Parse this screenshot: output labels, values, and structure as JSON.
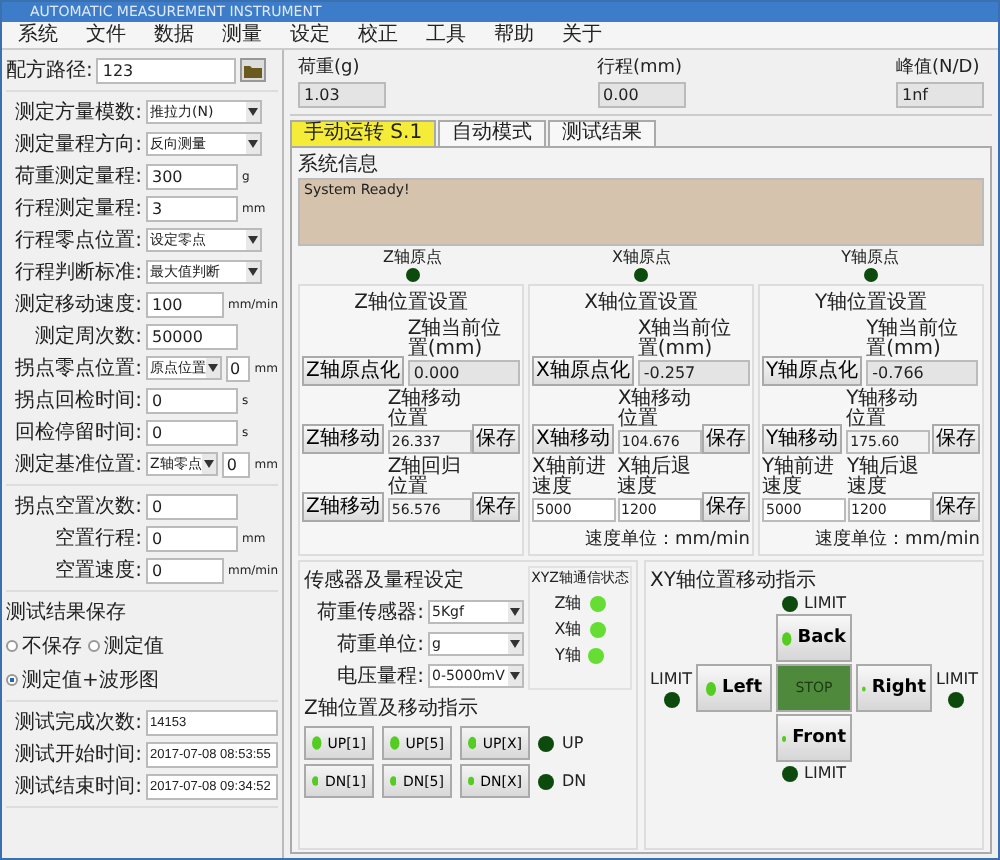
{
  "window": {
    "title": "AUTOMATIC MEASUREMENT INSTRUMENT"
  },
  "menu": [
    "系统",
    "文件",
    "数据",
    "测量",
    "设定",
    "校正",
    "工具",
    "帮助",
    "关于"
  ],
  "recipe": {
    "label": "配方路径:",
    "value": "123"
  },
  "settings": [
    {
      "label": "测定方量模数:",
      "kind": "select",
      "value": "推拉力(N)"
    },
    {
      "label": "测定量程方向:",
      "kind": "select",
      "value": "反向测量"
    },
    {
      "label": "荷重测定量程:",
      "kind": "input",
      "value": "300",
      "unit": "g"
    },
    {
      "label": "行程测定量程:",
      "kind": "input",
      "value": "3",
      "unit": "mm"
    },
    {
      "label": "行程零点位置:",
      "kind": "select",
      "value": "设定零点"
    },
    {
      "label": "行程判断标准:",
      "kind": "select",
      "value": "最大值判断"
    },
    {
      "label": "测定移动速度:",
      "kind": "input",
      "value": "100",
      "unit": "mm/min"
    },
    {
      "label": "测定周次数:",
      "kind": "input",
      "value": "50000"
    },
    {
      "label": "拐点零点位置:",
      "kind": "spin",
      "value": "原点位置",
      "spin": "0",
      "unit": "mm"
    },
    {
      "label": "拐点回检时间:",
      "kind": "input",
      "value": "0",
      "unit": "s"
    },
    {
      "label": "回检停留时间:",
      "kind": "input",
      "value": "0",
      "unit": "s"
    },
    {
      "label": "测定基准位置:",
      "kind": "spin",
      "value": "Z轴零点",
      "spin": "0",
      "unit": "mm"
    }
  ],
  "idle_settings": [
    {
      "label": "拐点空置次数:",
      "value": "0"
    },
    {
      "label": "空置行程:",
      "value": "0",
      "unit": "mm"
    },
    {
      "label": "空置速度:",
      "value": "0",
      "unit": "mm/min"
    }
  ],
  "save_group": {
    "title": "测试结果保存",
    "options": [
      {
        "label": "不保存",
        "selected": false
      },
      {
        "label": "测定值",
        "selected": false
      },
      {
        "label": "测定值+波形图",
        "selected": true
      }
    ]
  },
  "results": [
    {
      "label": "测试完成次数:",
      "value": "14153"
    },
    {
      "label": "测试开始时间:",
      "value": "2017-07-08 08:53:55"
    },
    {
      "label": "测试结束时间:",
      "value": "2017-07-08 09:34:52"
    }
  ],
  "readouts": [
    {
      "label": "荷重(g)",
      "value": "1.03"
    },
    {
      "label": "行程(mm)",
      "value": "0.00"
    },
    {
      "label": "峰值(N/D)",
      "value": "1nf"
    }
  ],
  "tabs": [
    {
      "label": "手动运转 S.1",
      "selected": true
    },
    {
      "label": "自动模式",
      "selected": false
    },
    {
      "label": "测试结果",
      "selected": false
    }
  ],
  "system_info": {
    "label": "系统信息",
    "text": "System Ready!"
  },
  "origin_leds": [
    {
      "label": "Z轴原点",
      "on": false
    },
    {
      "label": "X轴原点",
      "on": false
    },
    {
      "label": "Y轴原点",
      "on": false
    }
  ],
  "axes": [
    {
      "title": "Z轴位置设置",
      "home_button": "Z轴原点化",
      "current_label": "Z轴当前位置(mm)",
      "current": "0.000",
      "rows": [
        {
          "kind": "move",
          "button": "Z轴移动",
          "label": "Z轴移动位置",
          "value": "26.337",
          "save": "保存"
        },
        {
          "kind": "move",
          "button": "Z轴移动",
          "label": "Z轴回归位置",
          "value": "56.576",
          "save": "保存"
        }
      ]
    },
    {
      "title": "X轴位置设置",
      "home_button": "X轴原点化",
      "current_label": "X轴当前位置(mm)",
      "current": "-0.257",
      "note": "速度单位：mm/min",
      "rows": [
        {
          "kind": "move",
          "button": "X轴移动",
          "label": "X轴移动位置",
          "value": "104.676",
          "save": "保存"
        },
        {
          "kind": "speed",
          "fields": [
            {
              "label": "X轴前进速度",
              "value": "5000"
            },
            {
              "label": "X轴后退速度",
              "value": "1200"
            }
          ],
          "save": "保存"
        }
      ]
    },
    {
      "title": "Y轴位置设置",
      "home_button": "Y轴原点化",
      "current_label": "Y轴当前位置(mm)",
      "current": "-0.766",
      "note": "速度单位：mm/min",
      "rows": [
        {
          "kind": "move",
          "button": "Y轴移动",
          "label": "Y轴移动位置",
          "value": "175.60",
          "save": "保存"
        },
        {
          "kind": "speed",
          "fields": [
            {
              "label": "Y轴前进速度",
              "value": "5000"
            },
            {
              "label": "Y轴后退速度",
              "value": "1200"
            }
          ],
          "save": "保存"
        }
      ]
    }
  ],
  "sensor": {
    "title": "传感器及量程设定",
    "fields": [
      {
        "label": "荷重传感器:",
        "value": "5Kgf"
      },
      {
        "label": "荷重单位:",
        "value": "g"
      },
      {
        "label": "电压量程:",
        "value": "0-5000mV"
      }
    ]
  },
  "comm": {
    "title": "XYZ轴通信状态",
    "leds": [
      {
        "label": "Z轴",
        "on": true
      },
      {
        "label": "X轴",
        "on": true
      },
      {
        "label": "Y轴",
        "on": true
      }
    ]
  },
  "z_jog": {
    "title": "Z轴位置及移动指示",
    "rows": [
      {
        "buttons": [
          "UP[1]",
          "UP[5]",
          "UP[X]"
        ],
        "indicator": {
          "label": "UP",
          "on": false
        }
      },
      {
        "buttons": [
          "DN[1]",
          "DN[5]",
          "DN[X]"
        ],
        "indicator": {
          "label": "DN",
          "on": false
        }
      }
    ]
  },
  "xy_jog": {
    "title": "XY轴位置移动指示",
    "limits": [
      {
        "kind": "top",
        "label": "LIMIT",
        "on": false
      },
      {
        "kind": "left",
        "label": "LIMIT",
        "on": false
      },
      {
        "kind": "right",
        "label": "LIMIT",
        "on": false
      },
      {
        "kind": "bottom",
        "label": "LIMIT",
        "on": false
      }
    ],
    "buttons": [
      {
        "kind": "back",
        "label": "Back"
      },
      {
        "kind": "left",
        "label": "Left"
      },
      {
        "kind": "stop",
        "label": "STOP"
      },
      {
        "kind": "right",
        "label": "Right"
      },
      {
        "kind": "front",
        "label": "Front"
      }
    ]
  }
}
